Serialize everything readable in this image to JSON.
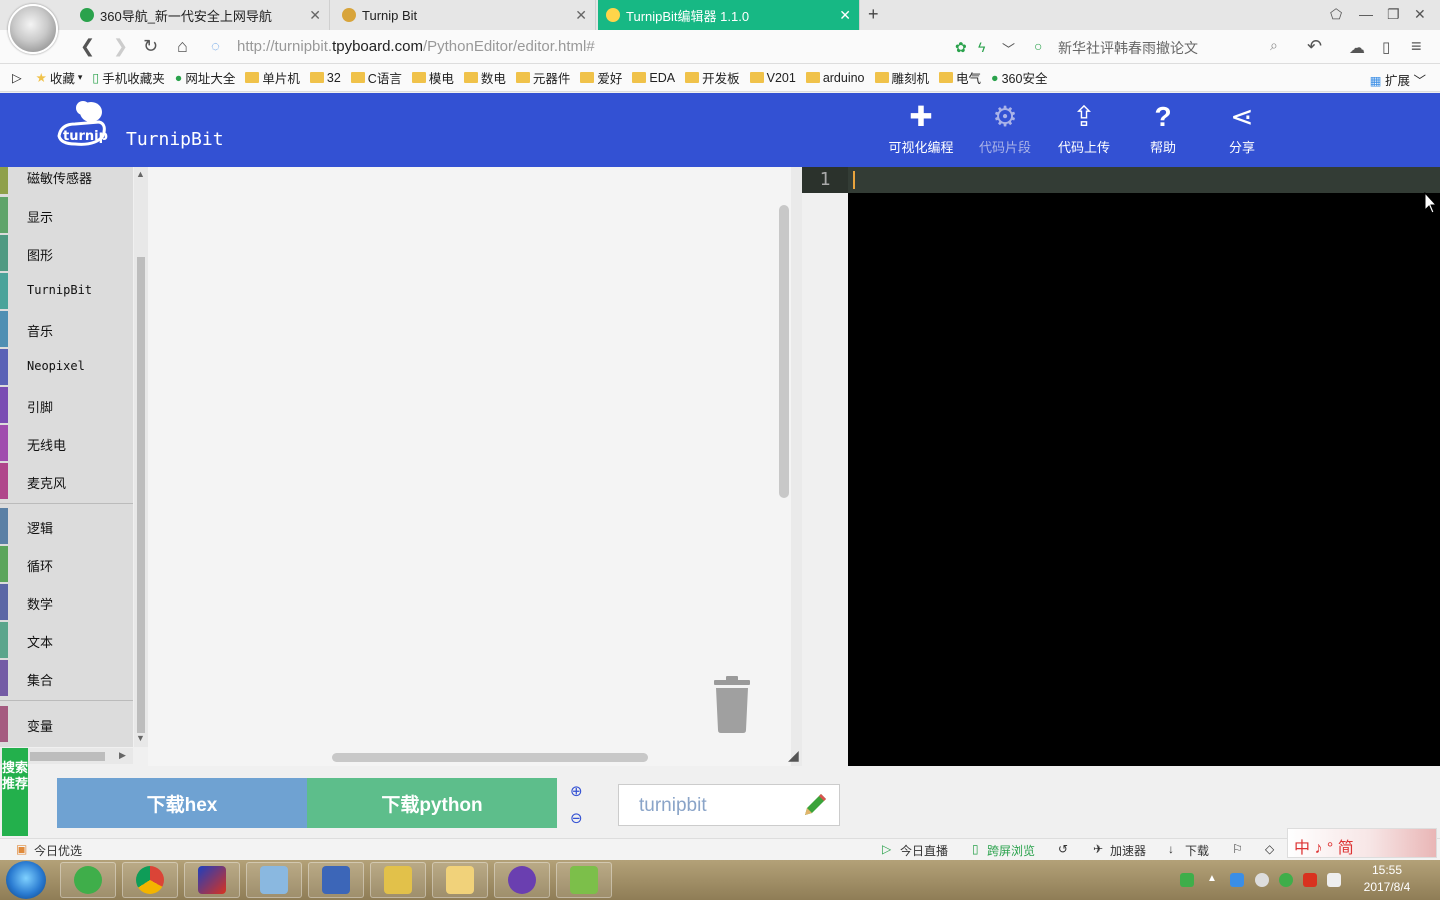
{
  "browser": {
    "tabs": [
      {
        "title": "360导航_新一代安全上网导航",
        "icon_color": "#2aa24c"
      },
      {
        "title": "Turnip Bit",
        "icon_color": "#d8a43a"
      },
      {
        "title": "TurnipBit编辑器 1.1.0",
        "icon_color": "#3351d3",
        "active": true
      }
    ],
    "url_prefix": "http://turnipbit.",
    "url_domain": "tpyboard.com",
    "url_path": "/PythonEditor/editor.html#",
    "search_text": "新华社评韩春雨撤论文",
    "bookmarks": [
      {
        "label": "收藏",
        "icon": "star-icon"
      },
      {
        "label": "手机收藏夹",
        "icon": "phone-icon"
      },
      {
        "label": "网址大全",
        "icon": "360-icon"
      },
      {
        "label": "单片机",
        "icon": "folder-icon"
      },
      {
        "label": "32",
        "icon": "folder-icon"
      },
      {
        "label": "C语言",
        "icon": "folder-icon"
      },
      {
        "label": "模电",
        "icon": "folder-icon"
      },
      {
        "label": "数电",
        "icon": "folder-icon"
      },
      {
        "label": "元器件",
        "icon": "folder-icon"
      },
      {
        "label": "爱好",
        "icon": "folder-icon"
      },
      {
        "label": "EDA",
        "icon": "folder-icon"
      },
      {
        "label": "开发板",
        "icon": "folder-icon"
      },
      {
        "label": "V201",
        "icon": "folder-icon"
      },
      {
        "label": "arduino",
        "icon": "folder-icon"
      },
      {
        "label": "雕刻机",
        "icon": "folder-icon"
      },
      {
        "label": "电气",
        "icon": "folder-icon"
      },
      {
        "label": "360安全",
        "icon": "360-icon"
      }
    ],
    "extensions_label": "扩展"
  },
  "app": {
    "title": "TurnipBit",
    "logo_text": "turnip",
    "menu": [
      {
        "label": "可视化编程",
        "icon": "puzzle-icon",
        "enabled": true
      },
      {
        "label": "代码片段",
        "icon": "gears-icon",
        "enabled": false
      },
      {
        "label": "代码上传",
        "icon": "upload-icon",
        "enabled": true
      },
      {
        "label": "帮助",
        "icon": "help-icon",
        "enabled": true
      },
      {
        "label": "分享",
        "icon": "share-icon",
        "enabled": true
      }
    ]
  },
  "toolbox": {
    "categories": [
      {
        "label": "磁敏传感器",
        "color": "#8fa04a"
      },
      {
        "label": "显示",
        "color": "#5fa46a"
      },
      {
        "label": "图形",
        "color": "#4f9a82"
      },
      {
        "label": "TurnipBit",
        "color": "#4aa39a"
      },
      {
        "label": "音乐",
        "color": "#4f8fb3"
      },
      {
        "label": "Neopixel",
        "color": "#5a62b6"
      },
      {
        "label": "引脚",
        "color": "#7a4cb3"
      },
      {
        "label": "无线电",
        "color": "#a04cae"
      },
      {
        "label": "麦克风",
        "color": "#b0468b"
      },
      {
        "label": "逻辑",
        "color": "#5b80a5"
      },
      {
        "label": "循环",
        "color": "#5ba55b"
      },
      {
        "label": "数学",
        "color": "#5b67a5"
      },
      {
        "label": "文本",
        "color": "#5ba58c"
      },
      {
        "label": "集合",
        "color": "#745ba5"
      },
      {
        "label": "变量",
        "color": "#a55b80"
      }
    ]
  },
  "editor": {
    "line_number": "1",
    "content": ""
  },
  "bottom": {
    "download_hex": "下载hex",
    "download_python": "下载python",
    "filename": "turnipbit",
    "side_banner": "搜索推荐"
  },
  "statusbar": {
    "left": "今日优选",
    "items": [
      "今日直播",
      "跨屏浏览",
      "加速器",
      "下载"
    ],
    "ime": "中 ♪ ° 简"
  },
  "taskbar": {
    "time": "15:55",
    "date": "2017/8/4"
  }
}
